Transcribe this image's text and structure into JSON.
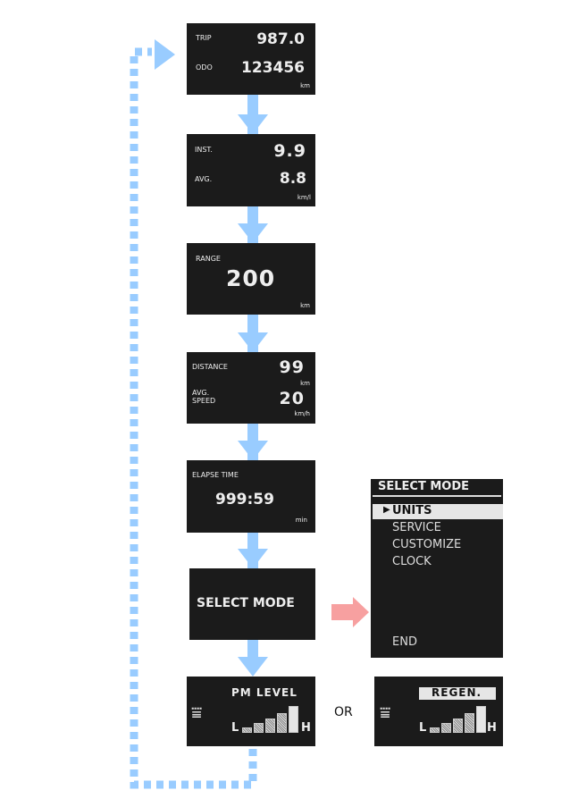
{
  "colors": {
    "flow_arrow": "#99ccff",
    "side_arrow": "#f7a0a0",
    "panel": "#1b1b1b"
  },
  "screens": {
    "trip": {
      "trip_label": "TRIP",
      "trip_value": "987.0",
      "odo_label": "ODO",
      "odo_value": "123456",
      "unit": "km"
    },
    "fuel": {
      "inst_label": "INST.",
      "inst_value": "9.9",
      "avg_label": "AVG.",
      "avg_value": "8.8",
      "unit": "km/l"
    },
    "range": {
      "label": "RANGE",
      "value": "200",
      "unit": "km"
    },
    "distance": {
      "distance_label": "DISTANCE",
      "distance_value": "99",
      "distance_unit": "km",
      "speed_label_1": "AVG.",
      "speed_label_2": "SPEED",
      "speed_value": "20",
      "speed_unit": "km/h"
    },
    "elapse": {
      "label": "ELAPSE TIME",
      "value": "999:59",
      "unit": "min"
    },
    "select": {
      "label": "SELECT MODE"
    },
    "pm": {
      "label": "PM LEVEL",
      "low": "L",
      "high": "H",
      "icon": "dpf-filter-icon"
    },
    "regen": {
      "label": "REGEN.",
      "low": "L",
      "high": "H",
      "icon": "dpf-filter-icon"
    }
  },
  "or_label": "OR",
  "menu": {
    "title": "SELECT MODE",
    "items": [
      "UNITS",
      "SERVICE",
      "CUSTOMIZE",
      "CLOCK"
    ],
    "selected": "UNITS",
    "end": "END"
  }
}
